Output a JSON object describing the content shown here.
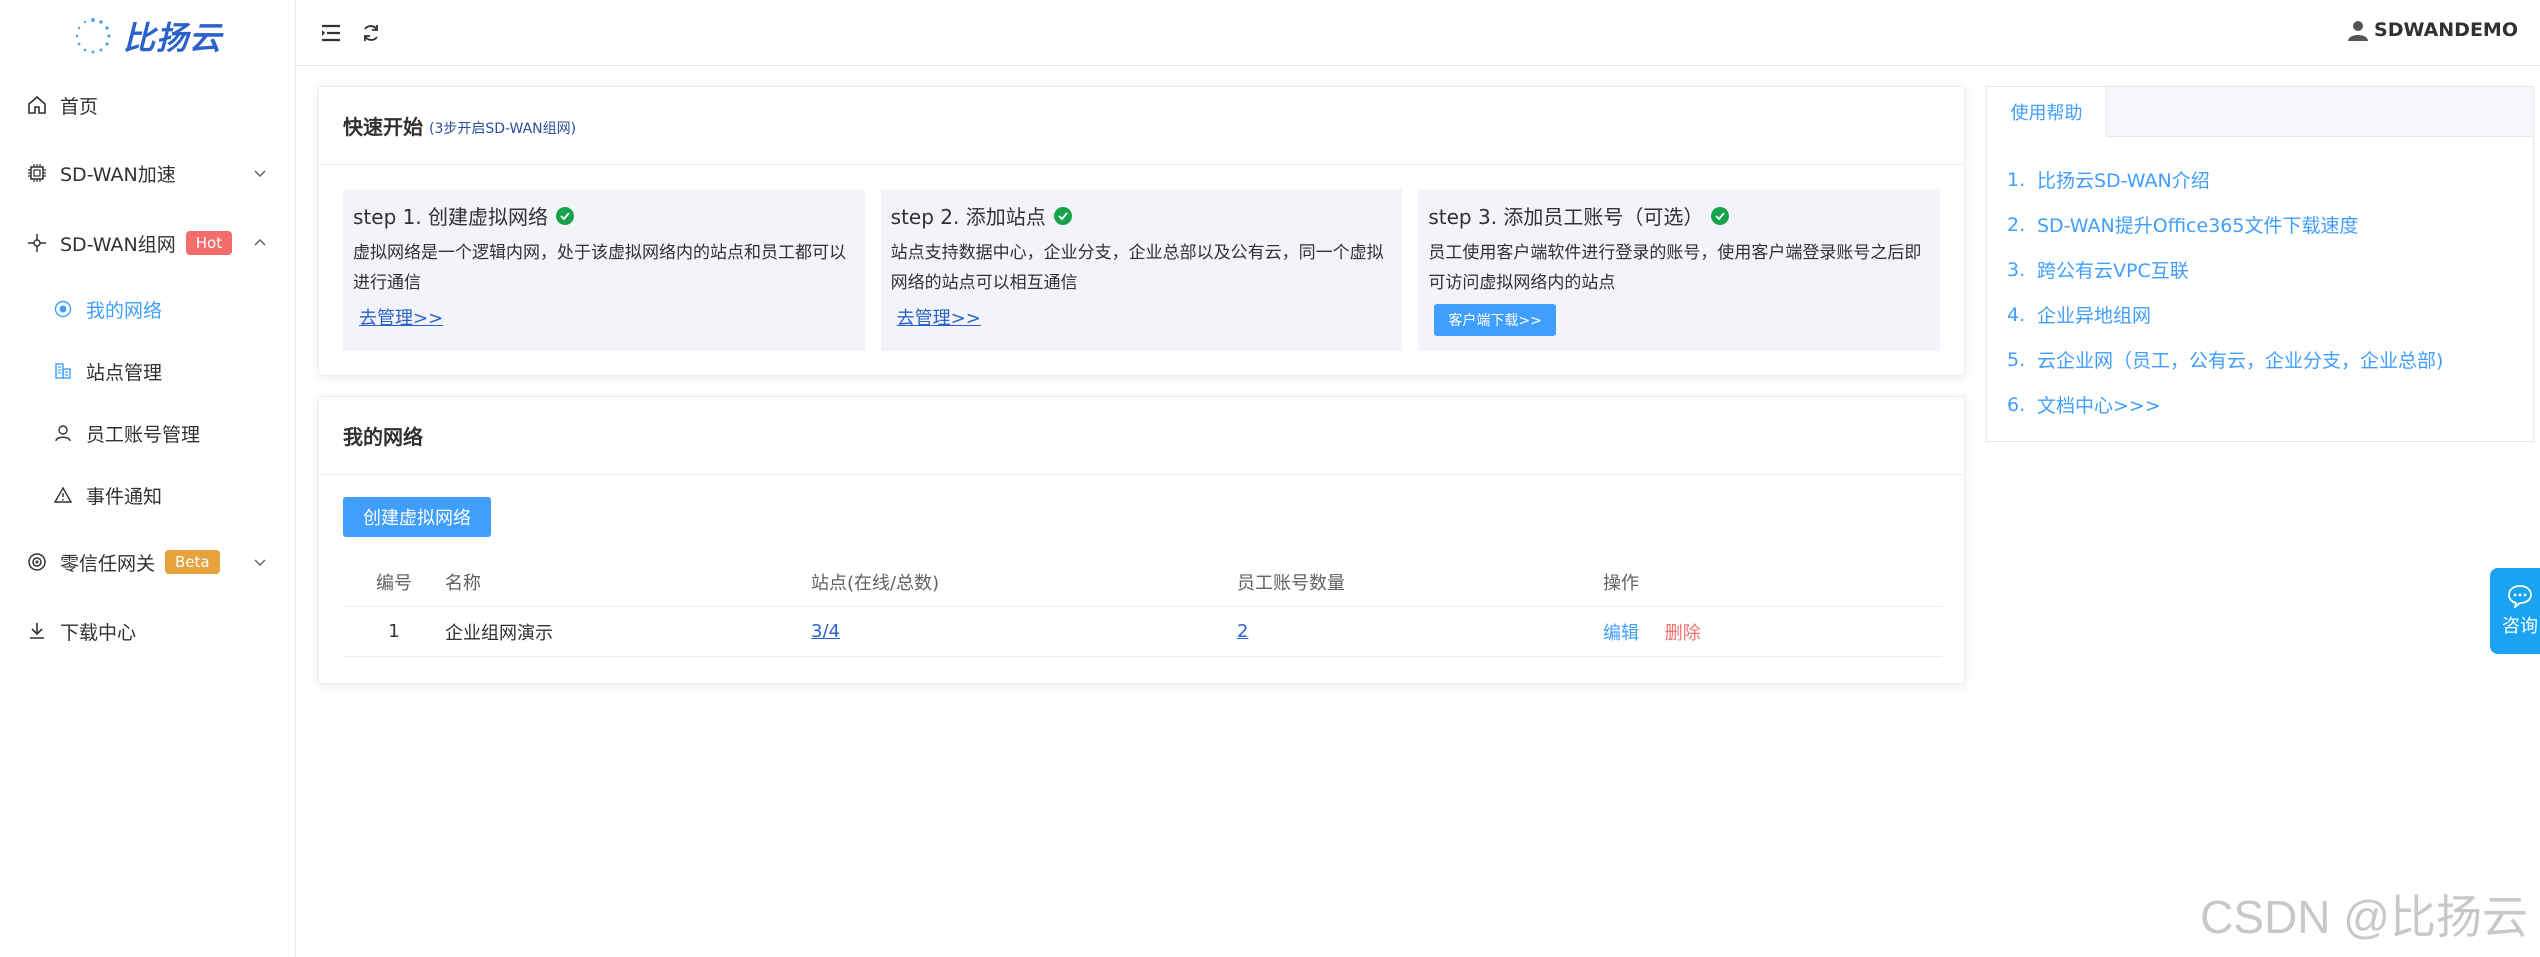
{
  "brand": {
    "logo_text": "比扬云"
  },
  "sidebar": {
    "items": [
      {
        "label": "首页",
        "icon": "home-icon"
      },
      {
        "label": "SD-WAN加速",
        "icon": "chip-icon"
      },
      {
        "label": "SD-WAN组网",
        "icon": "network-icon",
        "badge": "Hot"
      },
      {
        "label": "我的网络",
        "icon": "globe-icon",
        "active": true
      },
      {
        "label": "站点管理",
        "icon": "building-icon"
      },
      {
        "label": "员工账号管理",
        "icon": "user-icon"
      },
      {
        "label": "事件通知",
        "icon": "warning-icon"
      },
      {
        "label": "零信任网关",
        "icon": "shield-icon",
        "badge": "Beta"
      },
      {
        "label": "下载中心",
        "icon": "download-icon"
      }
    ]
  },
  "header": {
    "username": "SDWANDEMO"
  },
  "quickstart": {
    "title": "快速开始",
    "subtitle": "(3步开启SD-WAN组网)",
    "steps": [
      {
        "title": "step 1. 创建虚拟网络",
        "desc": "虚拟网络是一个逻辑内网，处于该虚拟网络内的站点和员工都可以进行通信",
        "action": "去管理>>"
      },
      {
        "title": "step 2. 添加站点",
        "desc": "站点支持数据中心，企业分支，企业总部以及公有云，同一个虚拟网络的站点可以相互通信",
        "action": "去管理>>"
      },
      {
        "title": "step 3. 添加员工账号（可选）",
        "desc": "员工使用客户端软件进行登录的账号，使用客户端登录账号之后即可访问虚拟网络内的站点",
        "action": "客户端下载>>"
      }
    ]
  },
  "networks": {
    "title": "我的网络",
    "create_label": "创建虚拟网络",
    "columns": [
      "编号",
      "名称",
      "站点(在线/总数)",
      "员工账号数量",
      "操作"
    ],
    "rows": [
      {
        "id": "1",
        "name": "企业组网演示",
        "sites": "3/4",
        "accounts": "2",
        "edit": "编辑",
        "delete": "删除"
      }
    ]
  },
  "help": {
    "tab": "使用帮助",
    "items": [
      {
        "num": "1.",
        "label": "比扬云SD-WAN介绍"
      },
      {
        "num": "2.",
        "label": "SD-WAN提升Office365文件下载速度"
      },
      {
        "num": "3.",
        "label": "跨公有云VPC互联"
      },
      {
        "num": "4.",
        "label": "企业异地组网"
      },
      {
        "num": "5.",
        "label": "云企业网（员工，公有云，企业分支，企业总部)"
      },
      {
        "num": "6.",
        "label": "文档中心>>>"
      }
    ]
  },
  "consult": {
    "label": "咨询"
  },
  "watermark": "CSDN @比扬云",
  "colors": {
    "primary": "#409eff",
    "danger": "#f56c6c",
    "warning": "#e6a23c",
    "success": "#17a34a",
    "brand": "#2a62c9"
  }
}
